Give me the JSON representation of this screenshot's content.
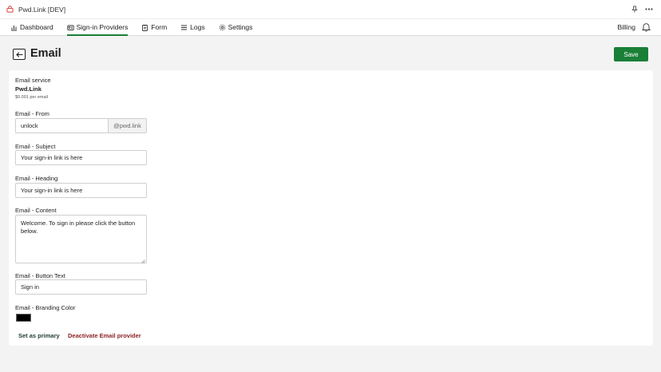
{
  "window": {
    "title": "Pwd.Link [DEV]"
  },
  "nav": {
    "items": [
      {
        "label": "Dashboard",
        "icon": "chart-icon",
        "active": false
      },
      {
        "label": "Sign-in Providers",
        "icon": "providers-icon",
        "active": true
      },
      {
        "label": "Form",
        "icon": "clipboard-icon",
        "active": false
      },
      {
        "label": "Logs",
        "icon": "list-icon",
        "active": false
      },
      {
        "label": "Settings",
        "icon": "gear-icon",
        "active": false
      }
    ],
    "billing_label": "Billing"
  },
  "header": {
    "title": "Email",
    "save_label": "Save"
  },
  "service": {
    "label": "Email service",
    "name": "Pwd.Link",
    "price": "$0.001 per email"
  },
  "fields": {
    "from": {
      "label": "Email - From",
      "value": "unlock",
      "suffix": "@pwd.link"
    },
    "subject": {
      "label": "Email - Subject",
      "value": "Your sign-in link is here"
    },
    "heading": {
      "label": "Email - Heading",
      "value": "Your sign-in link is here"
    },
    "content": {
      "label": "Email - Content",
      "value": "Welcome. To sign in please click the button below."
    },
    "button_text": {
      "label": "Email - Button Text",
      "value": "Sign in"
    },
    "branding_color": {
      "label": "Email - Branding Color",
      "value": "#000000"
    }
  },
  "actions": {
    "set_primary": "Set as primary",
    "deactivate": "Deactivate Email provider"
  },
  "colors": {
    "accent": "#1a7f37",
    "danger": "#8a1f1f"
  }
}
